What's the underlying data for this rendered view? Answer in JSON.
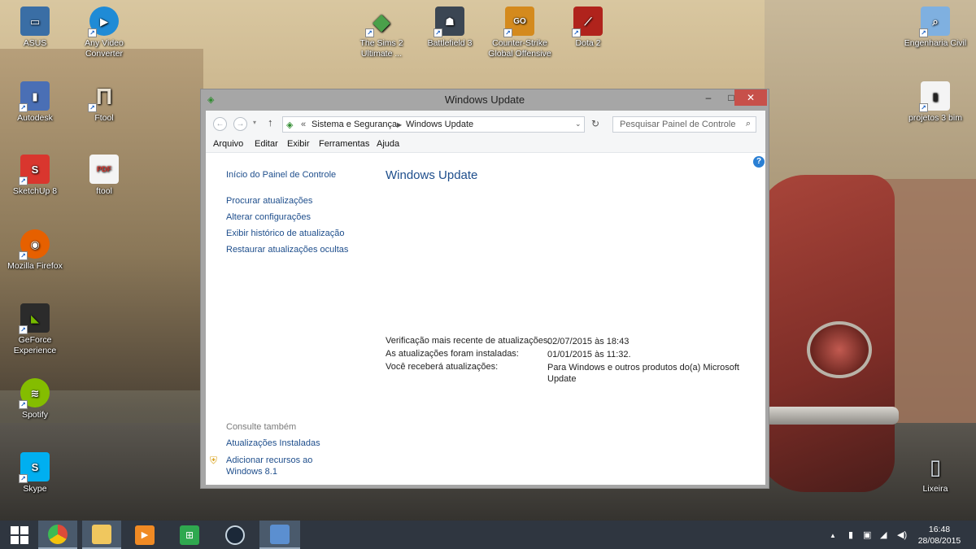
{
  "desktop": {
    "icons_left": [
      {
        "label": "ASUS",
        "icon": "asus-icon",
        "color": "#3a6ea5"
      },
      {
        "label": "Any Video Converter",
        "icon": "video-converter-icon",
        "color": "#1f8bd6"
      },
      {
        "label": "Autodesk",
        "icon": "autodesk-icon",
        "color": "#4a6fb5"
      },
      {
        "label": "Ftool",
        "icon": "ftool-icon",
        "color": "#e8e0d0"
      },
      {
        "label": "SketchUp 8",
        "icon": "sketchup-icon",
        "color": "#d9362e"
      },
      {
        "label": "ftool",
        "icon": "pdf-icon",
        "color": "#d9362e"
      },
      {
        "label": "Mozilla Firefox",
        "icon": "firefox-icon",
        "color": "#e66000"
      },
      {
        "label": "GeForce Experience",
        "icon": "geforce-icon",
        "color": "#76b900"
      },
      {
        "label": "Spotify",
        "icon": "spotify-icon",
        "color": "#84bd00"
      },
      {
        "label": "Skype",
        "icon": "skype-icon",
        "color": "#00aff0"
      }
    ],
    "icons_top": [
      {
        "label": "The Sims 2 Ultimate ...",
        "icon": "sims-icon",
        "color": "#4aa04a"
      },
      {
        "label": "Battlefield 3",
        "icon": "battlefield-icon",
        "color": "#3b4653"
      },
      {
        "label": "Counter-Strike Global Offensive",
        "icon": "csgo-icon",
        "color": "#d48a1d"
      },
      {
        "label": "Dota 2",
        "icon": "dota-icon",
        "color": "#b0231c"
      }
    ],
    "icons_right": [
      {
        "label": "Engenharia Civil",
        "icon": "folder-icon",
        "color": "#7fb0e0"
      },
      {
        "label": "projetos 3 bim",
        "icon": "file-icon",
        "color": "#222222"
      },
      {
        "label": "Lixeira",
        "icon": "recycle-bin-icon",
        "color": "#c9d3dc"
      }
    ]
  },
  "window": {
    "title": "Windows Update",
    "address": {
      "prefix": "«",
      "segments": [
        "Sistema e Segurança",
        "Windows Update"
      ]
    },
    "search_placeholder": "Pesquisar Painel de Controle",
    "menu": [
      "Arquivo",
      "Editar",
      "Exibir",
      "Ferramentas",
      "Ajuda"
    ],
    "sidebar": {
      "home": "Início do Painel de Controle",
      "links": [
        "Procurar atualizações",
        "Alterar configurações",
        "Exibir histórico de atualização",
        "Restaurar atualizações ocultas"
      ],
      "see_also_title": "Consulte também",
      "see_also": [
        "Atualizações Instaladas",
        "Adicionar recursos ao Windows 8.1"
      ]
    },
    "main": {
      "heading": "Windows Update",
      "details": [
        {
          "label": "Verificação mais recente de atualizações:",
          "value": "02/07/2015 às 18:43"
        },
        {
          "label": "As atualizações foram instaladas:",
          "value": "01/01/2015 às 11:32."
        },
        {
          "label": "Você receberá atualizações:",
          "value": "Para Windows e outros produtos do(a) Microsoft Update"
        }
      ]
    }
  },
  "taskbar": {
    "apps": [
      {
        "name": "start-button",
        "icon": "windows-logo-icon",
        "color": "#ffffff"
      },
      {
        "name": "chrome",
        "icon": "chrome-icon",
        "color": "#dd4b39"
      },
      {
        "name": "file-explorer",
        "icon": "folder-icon",
        "color": "#f0c75e"
      },
      {
        "name": "media-player",
        "icon": "media-player-icon",
        "color": "#f08a24"
      },
      {
        "name": "store",
        "icon": "store-icon",
        "color": "#2fa84f"
      },
      {
        "name": "steam",
        "icon": "steam-icon",
        "color": "#1b2838"
      },
      {
        "name": "control-panel",
        "icon": "control-panel-icon",
        "color": "#5b8fd0"
      }
    ],
    "clock": {
      "time": "16:48",
      "date": "28/08/2015"
    }
  }
}
